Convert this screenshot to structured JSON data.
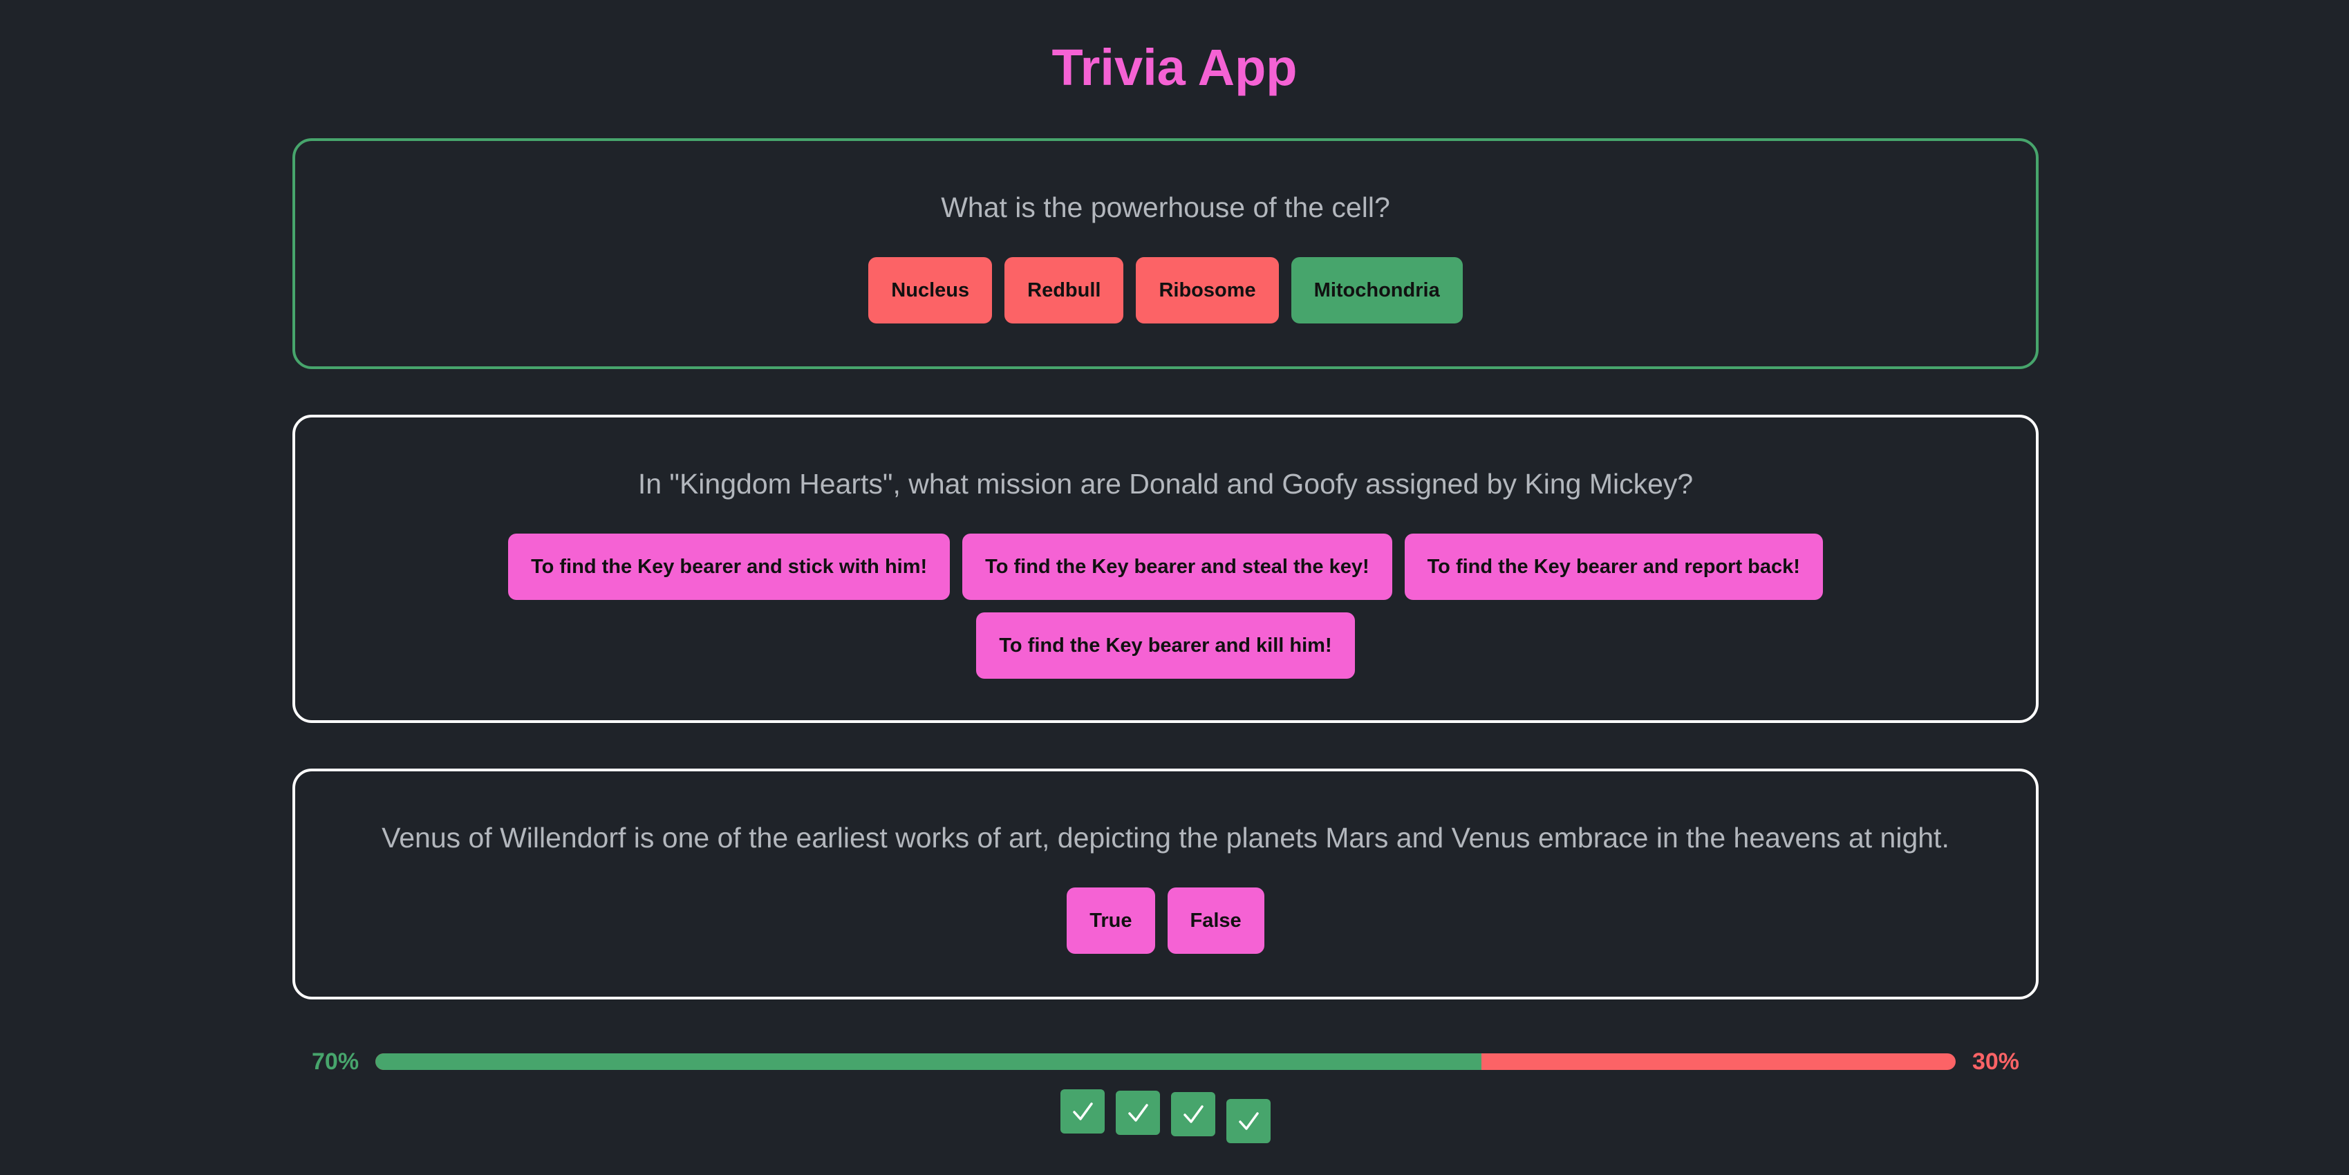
{
  "app": {
    "title": "Trivia App"
  },
  "colors": {
    "accent": "#f562d4",
    "correct": "#47a56c",
    "wrong": "#fc6366",
    "background": "#1f2329"
  },
  "questions": [
    {
      "text": "What is the powerhouse of the cell?",
      "answered": true,
      "answers": [
        {
          "label": "Nucleus",
          "state": "wrong"
        },
        {
          "label": "Redbull",
          "state": "wrong"
        },
        {
          "label": "Ribosome",
          "state": "wrong"
        },
        {
          "label": "Mitochondria",
          "state": "right"
        }
      ]
    },
    {
      "text": "In \"Kingdom Hearts\", what mission are Donald and Goofy assigned by King Mickey?",
      "answered": false,
      "answers": [
        {
          "label": "To find the Key bearer and stick with him!",
          "state": "unanswered"
        },
        {
          "label": "To find the Key bearer and steal the key!",
          "state": "unanswered"
        },
        {
          "label": "To find the Key bearer and report back!",
          "state": "unanswered"
        },
        {
          "label": "To find the Key bearer and kill him!",
          "state": "unanswered"
        }
      ]
    },
    {
      "text": "Venus of Willendorf is one of the earliest works of art, depicting the planets Mars and Venus embrace in the heavens at night.",
      "answered": false,
      "answers": [
        {
          "label": "True",
          "state": "unanswered"
        },
        {
          "label": "False",
          "state": "unanswered"
        }
      ]
    }
  ],
  "score": {
    "correct_label": "70%",
    "wrong_label": "30%",
    "correct_fraction": 0.7
  },
  "checkmarks": {
    "count": 4,
    "icon": "check-icon"
  }
}
